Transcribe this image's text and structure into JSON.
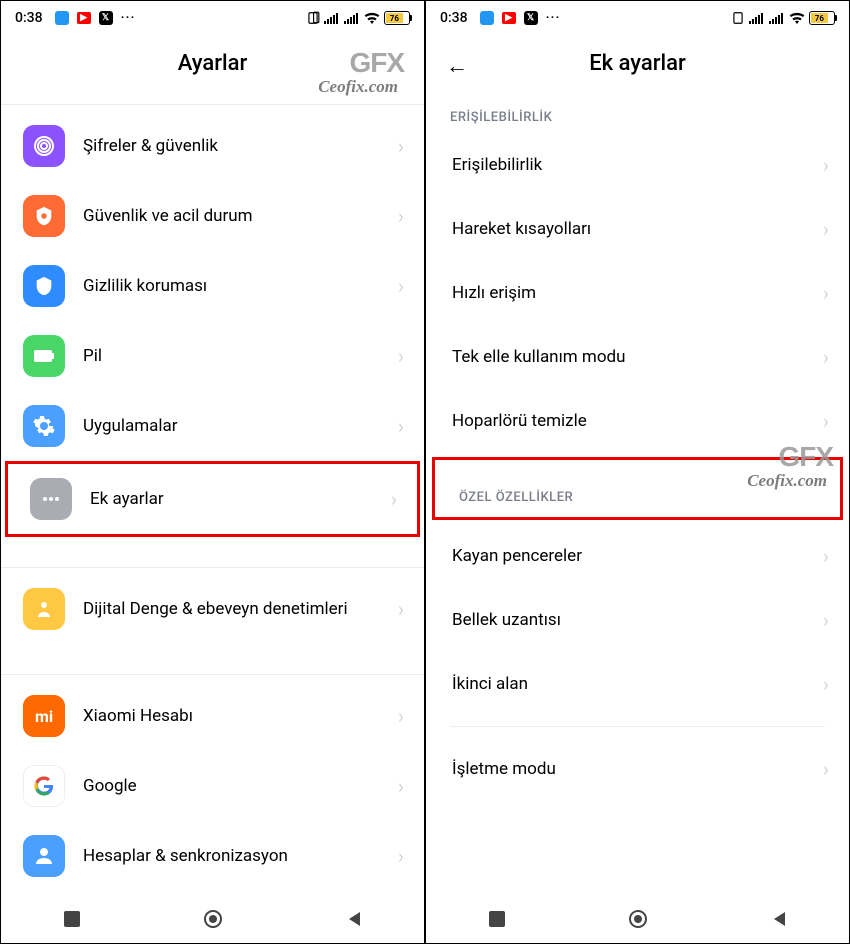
{
  "status": {
    "time": "0:38",
    "battery_pct": "76"
  },
  "left": {
    "title": "Ayarlar",
    "items": [
      {
        "label": "Şifreler & güvenlik"
      },
      {
        "label": "Güvenlik ve acil durum"
      },
      {
        "label": "Gizlilik koruması"
      },
      {
        "label": "Pil"
      },
      {
        "label": "Uygulamalar"
      },
      {
        "label": "Ek ayarlar"
      },
      {
        "label": "Dijital Denge & ebeveyn denetimleri"
      },
      {
        "label": "Xiaomi Hesabı"
      },
      {
        "label": "Google"
      },
      {
        "label": "Hesaplar & senkronizasyon"
      }
    ]
  },
  "right": {
    "title": "Ek ayarlar",
    "section1": "ERİŞİLEBİLİRLİK",
    "section2": "ÖZEL ÖZELLİKLER",
    "items1": [
      {
        "label": "Erişilebilirlik"
      },
      {
        "label": "Hareket kısayolları"
      },
      {
        "label": "Hızlı erişim"
      },
      {
        "label": "Tek elle kullanım modu"
      },
      {
        "label": "Hoparlörü temizle"
      }
    ],
    "items2": [
      {
        "label": "Kayan pencereler"
      },
      {
        "label": "Bellek uzantısı"
      },
      {
        "label": "İkinci alan"
      }
    ],
    "items3": [
      {
        "label": "İşletme modu"
      }
    ]
  },
  "watermark": {
    "gfx": "GFX",
    "url": "Ceofix.com"
  }
}
